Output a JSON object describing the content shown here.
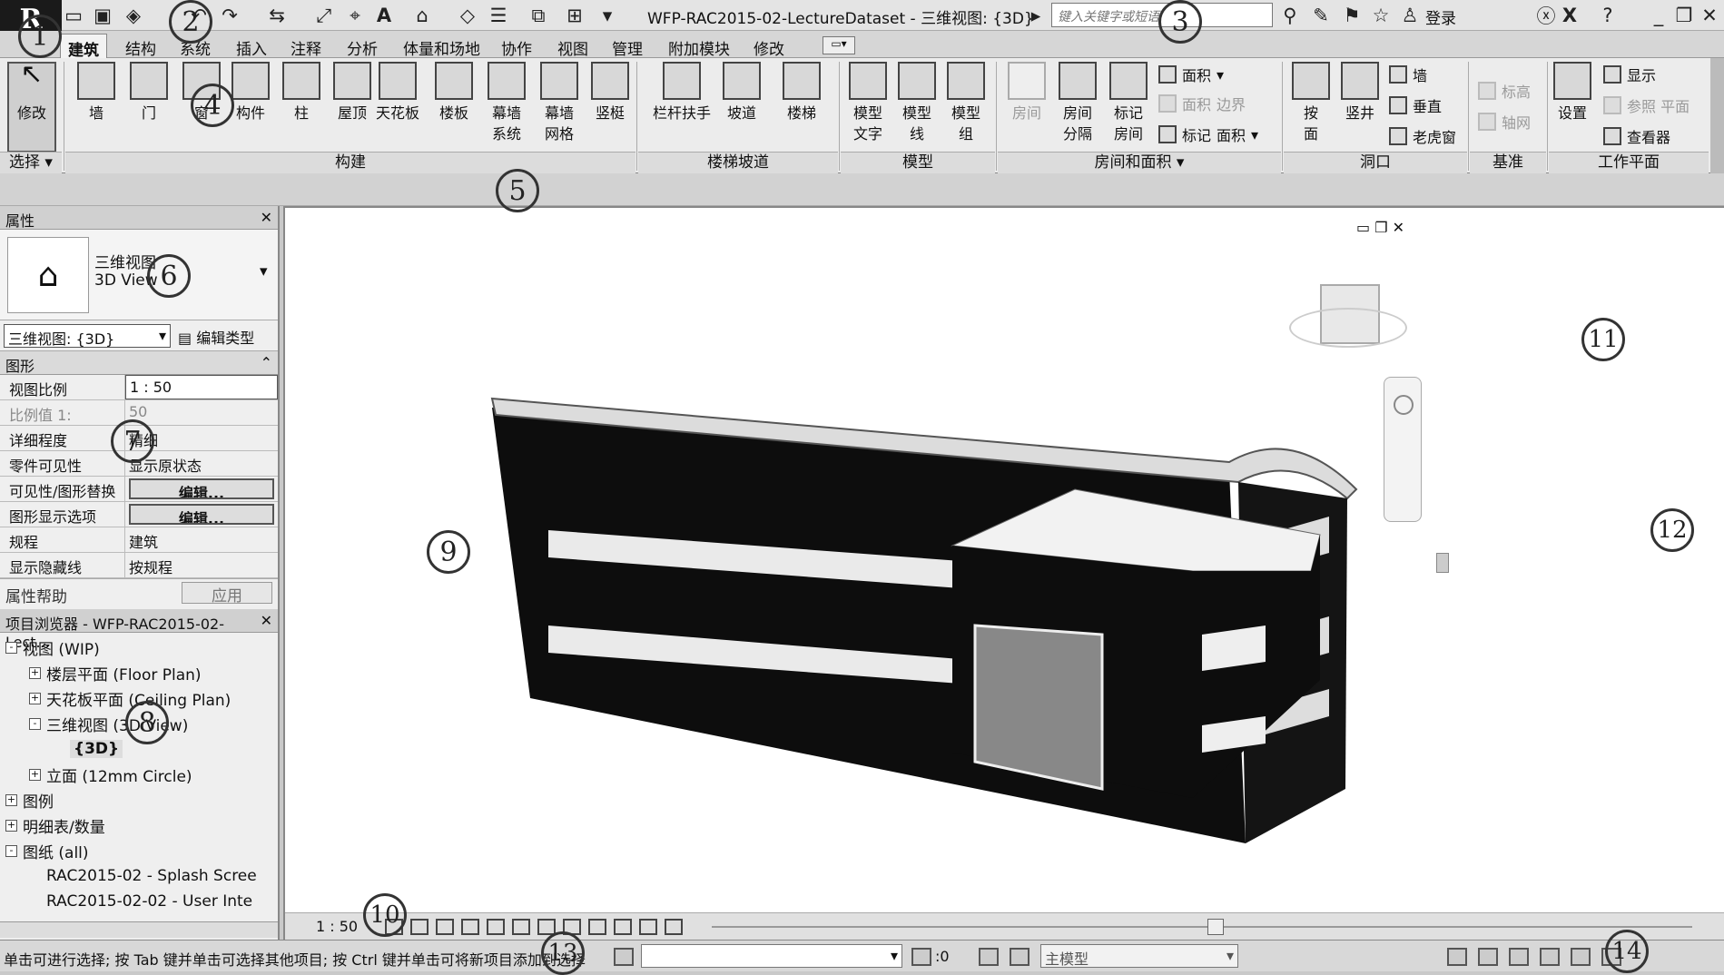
{
  "app": {
    "logo": "R",
    "window_title": "WFP-RAC2015-02-LectureDataset - 三维视图: {3D}",
    "search_placeholder": "键入关键字或短语",
    "login": "登录"
  },
  "tabs": [
    "建筑",
    "结构",
    "系统",
    "插入",
    "注释",
    "分析",
    "体量和场地",
    "协作",
    "视图",
    "管理",
    "附加模块",
    "修改"
  ],
  "ribbon": {
    "modify": "修改",
    "select": "选择",
    "build_tools": [
      [
        "墙",
        ""
      ],
      [
        "门",
        ""
      ],
      [
        "窗",
        ""
      ],
      [
        "构件",
        ""
      ],
      [
        "柱",
        ""
      ],
      [
        "屋顶",
        ""
      ],
      [
        "天花板",
        ""
      ],
      [
        "楼板",
        ""
      ],
      [
        "幕墙",
        "系统"
      ],
      [
        "幕墙",
        "网格"
      ],
      [
        "竖梃",
        ""
      ]
    ],
    "circ_tools": [
      "栏杆扶手",
      "坡道",
      "楼梯"
    ],
    "model_tools": [
      [
        "模型",
        "文字"
      ],
      [
        "模型",
        "线"
      ],
      [
        "模型",
        "组"
      ]
    ],
    "room_tools": [
      [
        "房间",
        ""
      ],
      [
        "房间",
        "分隔"
      ],
      [
        "标记",
        "房间"
      ]
    ],
    "area_small": [
      "面积",
      "面积",
      "边界",
      "标记",
      "面积"
    ],
    "opening_tools": [
      [
        "按",
        "面"
      ],
      [
        "竖井",
        ""
      ]
    ],
    "opening_small": [
      "墙",
      "垂直",
      "老虎窗"
    ],
    "datum_small": [
      "标高",
      "轴网"
    ],
    "workplane": {
      "set": "设置",
      "small": [
        "显示",
        "参照 平面",
        "查看器"
      ]
    },
    "panels": {
      "build": "构建",
      "circ": "楼梯坡道",
      "model": "模型",
      "room": "房间和面积",
      "opening": "洞口",
      "datum": "基准",
      "workplane": "工作平面"
    }
  },
  "properties": {
    "header": "属性",
    "type_cn": "三维视图",
    "type_en": "3D View",
    "selector": "三维视图: {3D}",
    "edit_type": "编辑类型",
    "group": "图形",
    "rows": [
      {
        "k": "视图比例",
        "v": "1 : 50"
      },
      {
        "k": "比例值 1:",
        "v": "50"
      },
      {
        "k": "详细程度",
        "v": "精细"
      },
      {
        "k": "零件可见性",
        "v": "显示原状态"
      },
      {
        "k": "可见性/图形替换",
        "v": "编辑..."
      },
      {
        "k": "图形显示选项",
        "v": "编辑..."
      },
      {
        "k": "规程",
        "v": "建筑"
      },
      {
        "k": "显示隐藏线",
        "v": "按规程"
      }
    ],
    "help": "属性帮助",
    "apply": "应用"
  },
  "browser": {
    "header": "项目浏览器 - WFP-RAC2015-02-Lect...",
    "items": [
      {
        "t": "视图 (WIP)",
        "d": 0,
        "s": "-"
      },
      {
        "t": "楼层平面 (Floor Plan)",
        "d": 1,
        "s": "+"
      },
      {
        "t": "天花板平面 (Ceiling Plan)",
        "d": 1,
        "s": "+"
      },
      {
        "t": "三维视图 (3D View)",
        "d": 1,
        "s": "-"
      },
      {
        "t": "{3D}",
        "d": 2,
        "s": ""
      },
      {
        "t": "立面 (12mm Circle)",
        "d": 1,
        "s": "+"
      },
      {
        "t": "图例",
        "d": 0,
        "s": "+"
      },
      {
        "t": "明细表/数量",
        "d": 0,
        "s": "+"
      },
      {
        "t": "图纸 (all)",
        "d": 0,
        "s": "-"
      },
      {
        "t": "RAC2015-02 - Splash Scree",
        "d": 1,
        "s": ""
      },
      {
        "t": "RAC2015-02-02 - User Inte",
        "d": 1,
        "s": ""
      }
    ]
  },
  "viewctl": {
    "scale": "1 : 50"
  },
  "status": {
    "text": "单击可进行选择; 按 Tab 键并单击可选择其他项目; 按 Ctrl 键并单击可将新项目添加到选择",
    "filter_count": ":0",
    "model": "主模型"
  },
  "callouts": [
    "1",
    "2",
    "3",
    "4",
    "5",
    "6",
    "7",
    "8",
    "9",
    "10",
    "11",
    "12",
    "13",
    "14"
  ]
}
